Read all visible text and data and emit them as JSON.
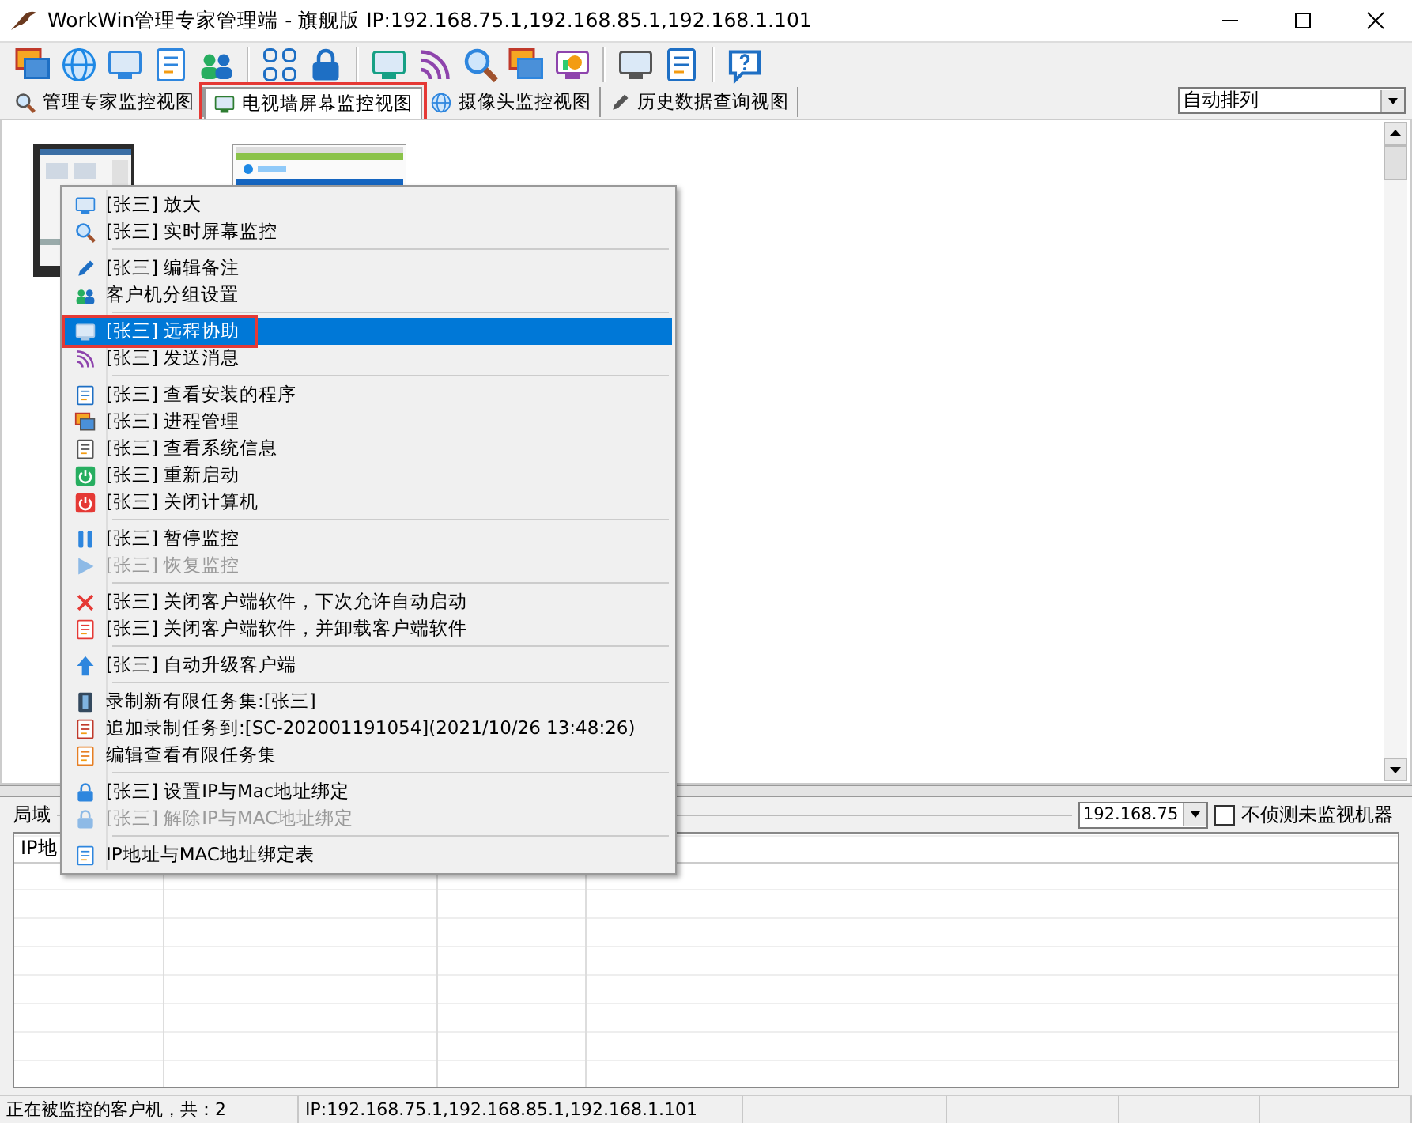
{
  "window": {
    "title": "WorkWin管理专家管理端 - 旗舰版 IP:192.168.75.1,192.168.85.1,192.168.1.101"
  },
  "tabs": [
    {
      "label": "管理专家监控视图",
      "selected": false,
      "annotated": false
    },
    {
      "label": "电视墙屏幕监控视图",
      "selected": true,
      "annotated": true
    },
    {
      "label": "摄像头监控视图",
      "selected": false,
      "annotated": false
    },
    {
      "label": "历史数据查询视图",
      "selected": false,
      "annotated": false
    }
  ],
  "arrange_dropdown": {
    "value": "自动排列"
  },
  "context_menu": {
    "items": [
      {
        "kind": "item",
        "label": "[张三] 放大",
        "selected": false,
        "disabled": false,
        "annotated": false
      },
      {
        "kind": "item",
        "label": "[张三] 实时屏幕监控",
        "selected": false,
        "disabled": false,
        "annotated": false
      },
      {
        "kind": "separator"
      },
      {
        "kind": "item",
        "label": "[张三] 编辑备注",
        "selected": false,
        "disabled": false,
        "annotated": false
      },
      {
        "kind": "item",
        "label": "客户机分组设置",
        "selected": false,
        "disabled": false,
        "annotated": false
      },
      {
        "kind": "separator"
      },
      {
        "kind": "item",
        "label": "[张三] 远程协助",
        "selected": true,
        "disabled": false,
        "annotated": true
      },
      {
        "kind": "item",
        "label": "[张三] 发送消息",
        "selected": false,
        "disabled": false,
        "annotated": false
      },
      {
        "kind": "separator"
      },
      {
        "kind": "item",
        "label": "[张三] 查看安装的程序",
        "selected": false,
        "disabled": false,
        "annotated": false
      },
      {
        "kind": "item",
        "label": "[张三] 进程管理",
        "selected": false,
        "disabled": false,
        "annotated": false
      },
      {
        "kind": "item",
        "label": "[张三] 查看系统信息",
        "selected": false,
        "disabled": false,
        "annotated": false
      },
      {
        "kind": "item",
        "label": "[张三] 重新启动",
        "selected": false,
        "disabled": false,
        "annotated": false
      },
      {
        "kind": "item",
        "label": "[张三] 关闭计算机",
        "selected": false,
        "disabled": false,
        "annotated": false
      },
      {
        "kind": "separator"
      },
      {
        "kind": "item",
        "label": "[张三] 暂停监控",
        "selected": false,
        "disabled": false,
        "annotated": false
      },
      {
        "kind": "item",
        "label": "[张三] 恢复监控",
        "selected": false,
        "disabled": true,
        "annotated": false
      },
      {
        "kind": "separator"
      },
      {
        "kind": "item",
        "label": "[张三] 关闭客户端软件，下次允许自动启动",
        "selected": false,
        "disabled": false,
        "annotated": false
      },
      {
        "kind": "item",
        "label": "[张三] 关闭客户端软件，并卸载客户端软件",
        "selected": false,
        "disabled": false,
        "annotated": false
      },
      {
        "kind": "separator"
      },
      {
        "kind": "item",
        "label": "[张三] 自动升级客户端",
        "selected": false,
        "disabled": false,
        "annotated": false
      },
      {
        "kind": "separator"
      },
      {
        "kind": "item",
        "label": "录制新有限任务集:[张三]",
        "selected": false,
        "disabled": false,
        "annotated": false
      },
      {
        "kind": "item",
        "label": "追加录制任务到:[SC-202001191054](2021/10/26 13:48:26)",
        "selected": false,
        "disabled": false,
        "annotated": false
      },
      {
        "kind": "item",
        "label": "编辑查看有限任务集",
        "selected": false,
        "disabled": false,
        "annotated": false
      },
      {
        "kind": "separator"
      },
      {
        "kind": "item",
        "label": "[张三] 设置IP与Mac地址绑定",
        "selected": false,
        "disabled": false,
        "annotated": false
      },
      {
        "kind": "item",
        "label": "[张三] 解除IP与MAC地址绑定",
        "selected": false,
        "disabled": true,
        "annotated": false
      },
      {
        "kind": "separator"
      },
      {
        "kind": "item",
        "label": "IP地址与MAC地址绑定表",
        "selected": false,
        "disabled": false,
        "annotated": false
      }
    ]
  },
  "network_panel": {
    "title": "局域",
    "ip_dropdown": {
      "value": "192.168.75"
    },
    "checkbox": {
      "label": "不侦测未监视机器",
      "checked": false
    },
    "table": {
      "columns": [
        "IP地"
      ]
    }
  },
  "status_bar": [
    "正在被监控的客户机，共：2",
    "IP:192.168.75.1,192.168.85.1,192.168.1.101"
  ]
}
